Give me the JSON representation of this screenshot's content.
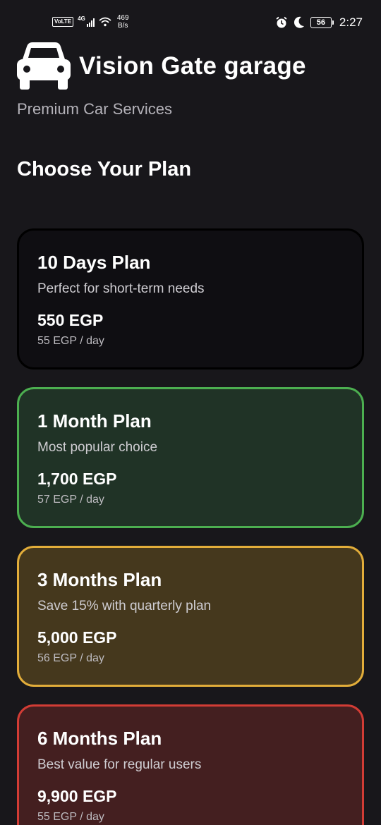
{
  "status_bar": {
    "volte": "VoLTE",
    "network": "4G",
    "speed_value": "469",
    "speed_unit": "B/s",
    "battery": "56",
    "time": "2:27",
    "icons": [
      "alarm-icon",
      "moon-icon",
      "battery-icon",
      "wifi-icon",
      "signal-icon"
    ]
  },
  "header": {
    "icon": "car-icon",
    "title": "Vision Gate garage",
    "subtitle": "Premium Car Services"
  },
  "section_title": "Choose Your Plan",
  "plans": [
    {
      "name": "10 Days Plan",
      "description": "Perfect for short-term needs",
      "price": "550 EGP",
      "per_day": "55 EGP / day",
      "border_color": "#000000",
      "background": "#0f0e12"
    },
    {
      "name": "1 Month Plan",
      "description": "Most popular choice",
      "price": "1,700 EGP",
      "per_day": "57 EGP / day",
      "border_color": "#4caf50",
      "background": "#203326"
    },
    {
      "name": "3 Months Plan",
      "description": "Save 15% with quarterly plan",
      "price": "5,000 EGP",
      "per_day": "56 EGP / day",
      "border_color": "#e2ad3a",
      "background": "#45381d"
    },
    {
      "name": "6 Months Plan",
      "description": "Best value for regular users",
      "price": "9,900 EGP",
      "per_day": "55 EGP / day",
      "border_color": "#d23c35",
      "background": "#441f20"
    }
  ]
}
